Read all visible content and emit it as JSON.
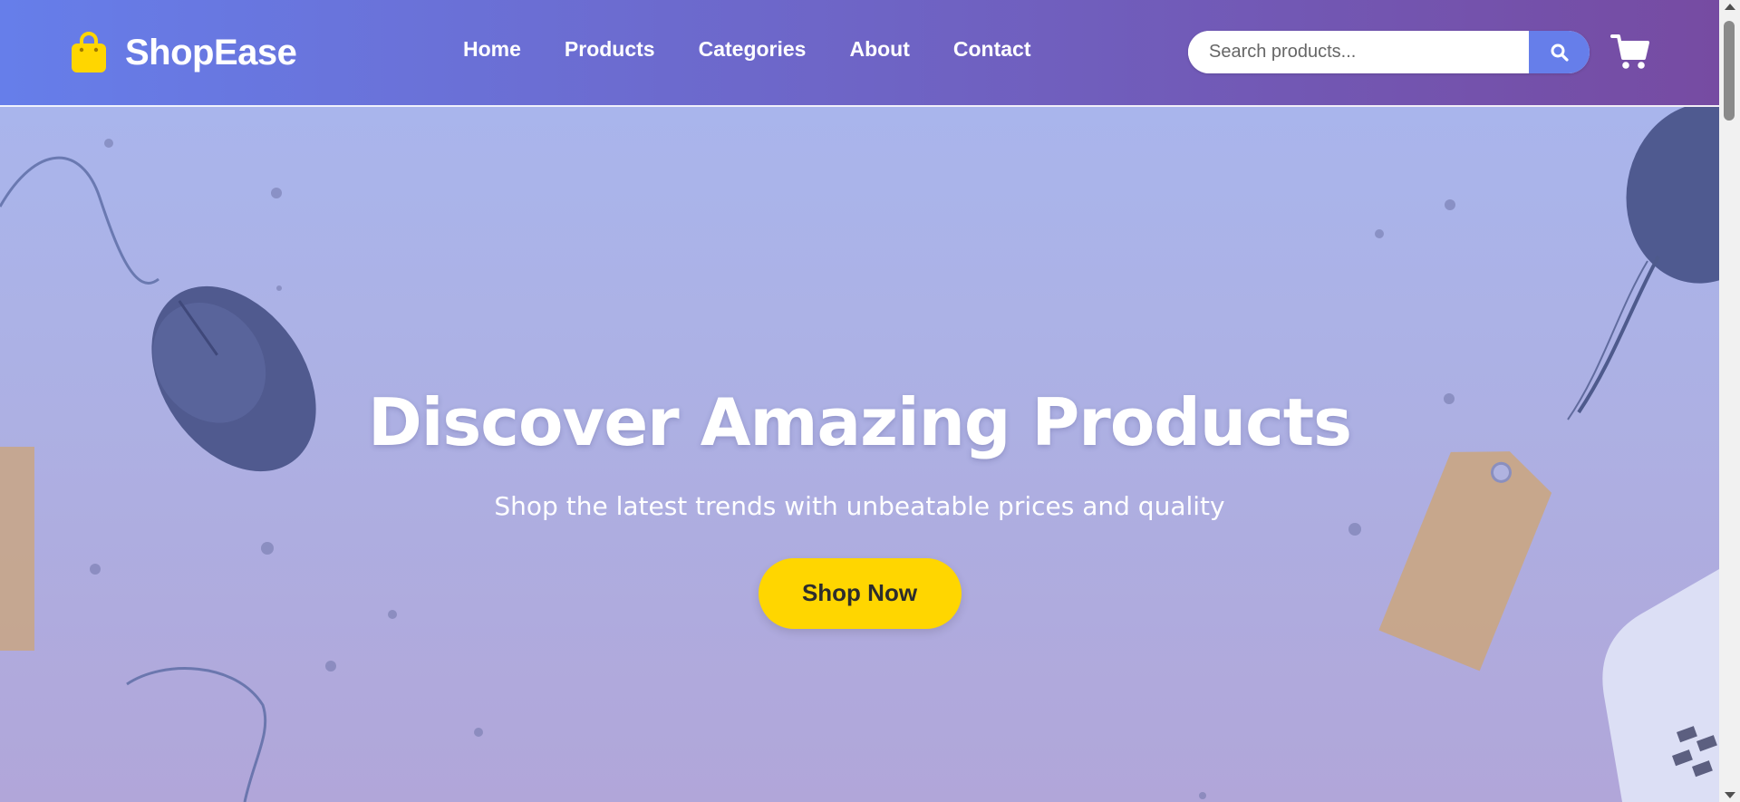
{
  "header": {
    "brand": "ShopEase",
    "logo_icon": "shopping-bag-icon",
    "nav": [
      {
        "label": "Home"
      },
      {
        "label": "Products"
      },
      {
        "label": "Categories"
      },
      {
        "label": "About"
      },
      {
        "label": "Contact"
      }
    ],
    "search": {
      "placeholder": "Search products...",
      "value": "",
      "icon": "search-icon"
    },
    "cart_icon": "shopping-cart-icon"
  },
  "hero": {
    "title": "Discover Amazing Products",
    "subtitle": "Shop the latest trends with unbeatable prices and quality",
    "cta_label": "Shop Now"
  },
  "colors": {
    "header_gradient_start": "#667eea",
    "header_gradient_end": "#764ba2",
    "accent_yellow": "#ffd600",
    "search_button": "#667eea"
  }
}
